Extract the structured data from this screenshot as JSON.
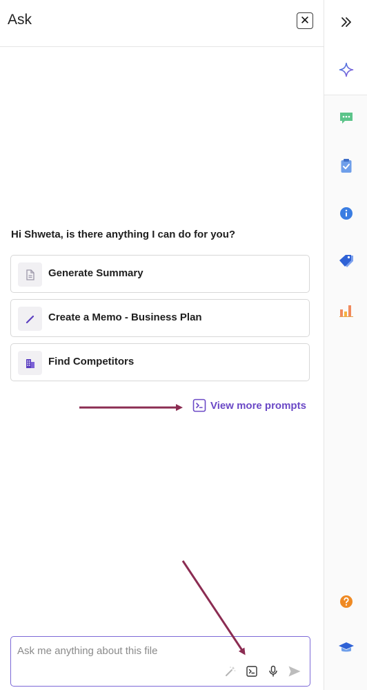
{
  "header": {
    "title": "Ask",
    "close_label": "✕"
  },
  "greeting": "Hi Shweta, is there anything I can do for you?",
  "prompts": [
    {
      "label": "Generate Summary",
      "icon": "document-icon"
    },
    {
      "label": "Create a Memo - Business Plan",
      "icon": "pen-icon"
    },
    {
      "label": "Find Competitors",
      "icon": "building-icon"
    }
  ],
  "view_more": {
    "label": "View more prompts",
    "icon": "terminal-icon"
  },
  "input": {
    "placeholder": "Ask me anything about this file",
    "value": ""
  },
  "toolbar": [
    "magic-wand-icon",
    "terminal-icon",
    "microphone-icon",
    "send-icon"
  ],
  "rail": [
    "expand-icon",
    "sparkle-icon",
    "chat-icon",
    "clipboard-icon",
    "info-icon",
    "tag-icon",
    "bar-chart-icon",
    "help-icon",
    "graduation-cap-icon"
  ],
  "colors": {
    "accent": "#6a48c6",
    "annotation_arrow": "#8b2c52",
    "border_focus": "#7b68d6"
  }
}
